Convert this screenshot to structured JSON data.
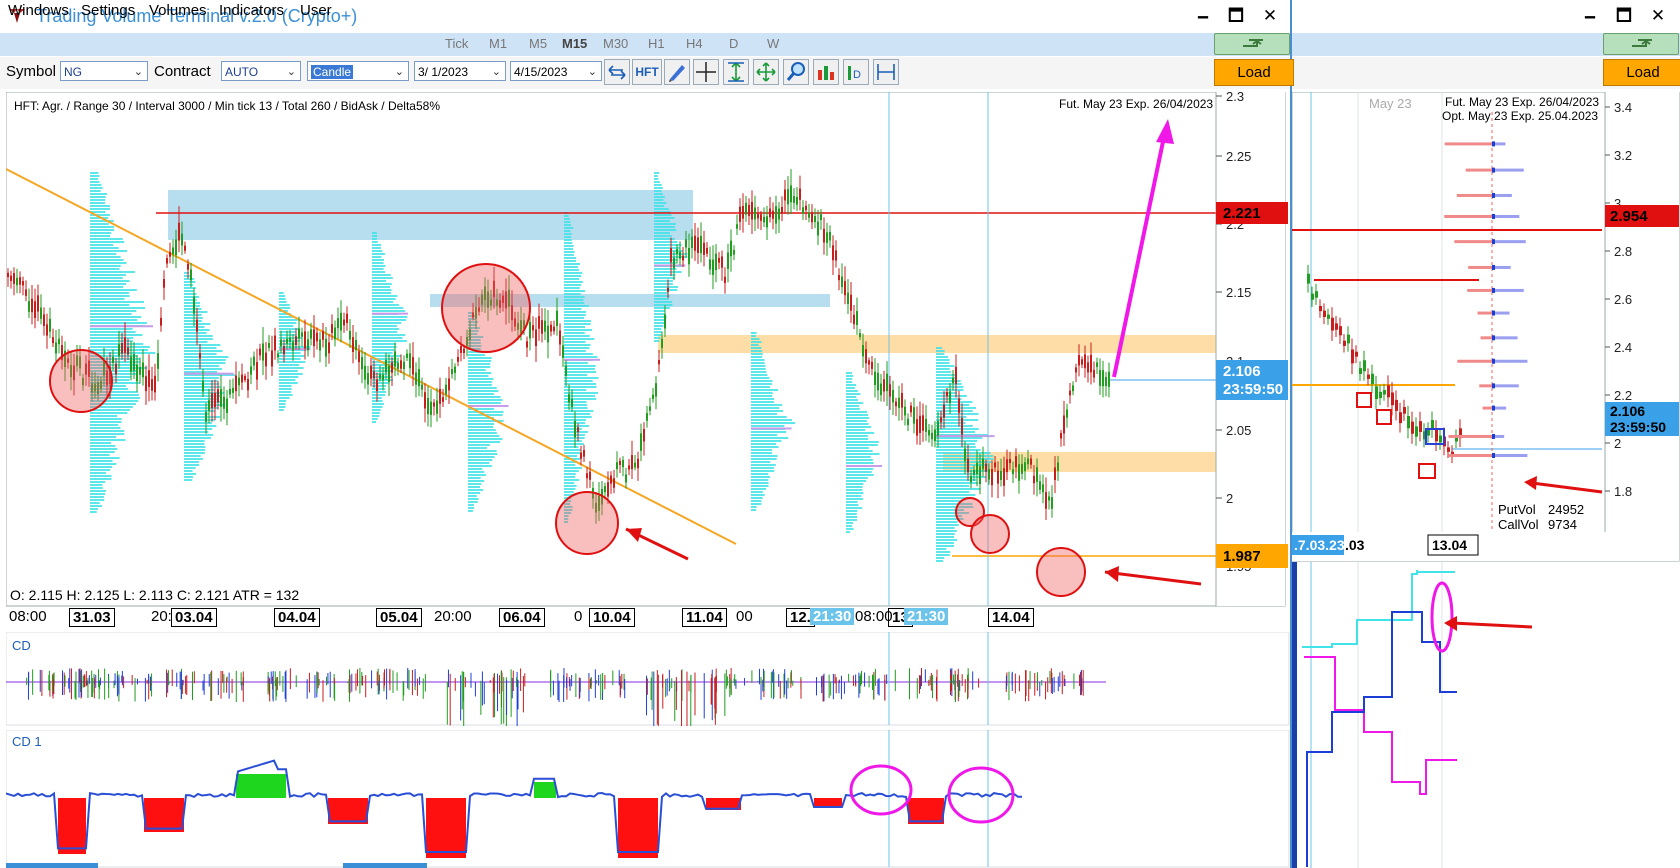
{
  "window": {
    "title": "Trading Volume Terminal v.2.0 (Crypto+)",
    "minimize_glyph": "🗕",
    "maximize_glyph": "🗖",
    "close_glyph": "✕"
  },
  "menu": {
    "items": [
      "Windows",
      "Settings",
      "Volumes",
      "Indicators",
      "User"
    ]
  },
  "timeframes": {
    "items": [
      "Tick",
      "M1",
      "M5",
      "M15",
      "M30",
      "H1",
      "H4",
      "D",
      "W"
    ],
    "active": "M15"
  },
  "toolbar": {
    "symbol_label": "Symbol",
    "symbol_value": "NG",
    "contract_label": "Contract",
    "contract_value": "AUTO",
    "chart_type_value": "Candle",
    "date_from": "3/ 1/2023",
    "date_to": "4/15/2023",
    "hft_label": "HFT",
    "load_label": "Load",
    "icons": [
      "arrows-icon",
      "hft-button",
      "pen-icon",
      "crosshair-icon",
      "fit-vertical-icon",
      "fit-all-icon",
      "zoom-icon",
      "bars-icon",
      "delta-icon",
      "range-icon"
    ]
  },
  "main_chart": {
    "info": "HFT: Agr. / Range 30 / Interval 3000 / Min tick 13 / Total 260 / BidAsk / Delta58%",
    "contract_info": "Fut. May 23 Exp. 26/04/2023",
    "ohlc": "O: 2.115  H: 2.125  L: 2.113  C: 2.121  ATR = 132",
    "price_ticks": [
      "2.3",
      "2.25",
      "2.2",
      "2.15",
      "2.1",
      "2.05",
      "2",
      "1.95"
    ],
    "levels": {
      "red": "2.221",
      "current_price": "2.106",
      "current_time": "23:59:50",
      "orange": "1.987"
    },
    "time_labels": [
      {
        "text": "08:00",
        "boxed": false
      },
      {
        "text": "31.03",
        "boxed": true
      },
      {
        "text": "20:",
        "boxed": false
      },
      {
        "text": "03.04",
        "boxed": true
      },
      {
        "text": "04.04",
        "boxed": true
      },
      {
        "text": "05.04",
        "boxed": true
      },
      {
        "text": "20:00",
        "boxed": false
      },
      {
        "text": "06.04",
        "boxed": true
      },
      {
        "text": "0",
        "boxed": false
      },
      {
        "text": "10.04",
        "boxed": true
      },
      {
        "text": "11.04",
        "boxed": true
      },
      {
        "text": "00",
        "boxed": false
      },
      {
        "text": "12.",
        "boxed": true
      },
      {
        "text": "21:30",
        "boxed": false,
        "highlight": true
      },
      {
        "text": "08:00",
        "boxed": false
      },
      {
        "text": "13",
        "boxed": true
      },
      {
        "text": "21:30",
        "boxed": false,
        "highlight": true
      },
      {
        "text": "14.04",
        "boxed": true
      }
    ]
  },
  "indicators": {
    "cd_label": "CD",
    "cd1_label": "CD 1"
  },
  "right_panel": {
    "contract_info_1": "Fut. May 23 Exp. 26/04/2023",
    "contract_info_2": "Opt. May 23 Exp. 25.04.2023",
    "month_label": "May 23",
    "price_ticks": [
      "3.4",
      "3.2",
      "3",
      "2.8",
      "2.6",
      "2.4",
      "2.2",
      "2",
      "1.8"
    ],
    "levels": {
      "red": "2.954",
      "current_price": "2.106",
      "current_time": "23:59:50"
    },
    "put_vol_label": "PutVol",
    "put_vol": "24952",
    "call_vol_label": "CallVol",
    "call_vol": "9734",
    "time_labels": [
      ".7.03.23",
      ".03",
      "13.04"
    ]
  },
  "colors": {
    "accent_blue": "#3a8fd6",
    "menu_bg": "#cfe3f7",
    "load_orange": "#ffa700",
    "candle_green": "#1f9e1f",
    "candle_red": "#c81e1e",
    "profile_cyan": "#3fe3e8",
    "level_red": "#e01010",
    "level_orange": "#ffa700",
    "current_blue": "#3aa0e8",
    "magenta": "#f018e8"
  }
}
